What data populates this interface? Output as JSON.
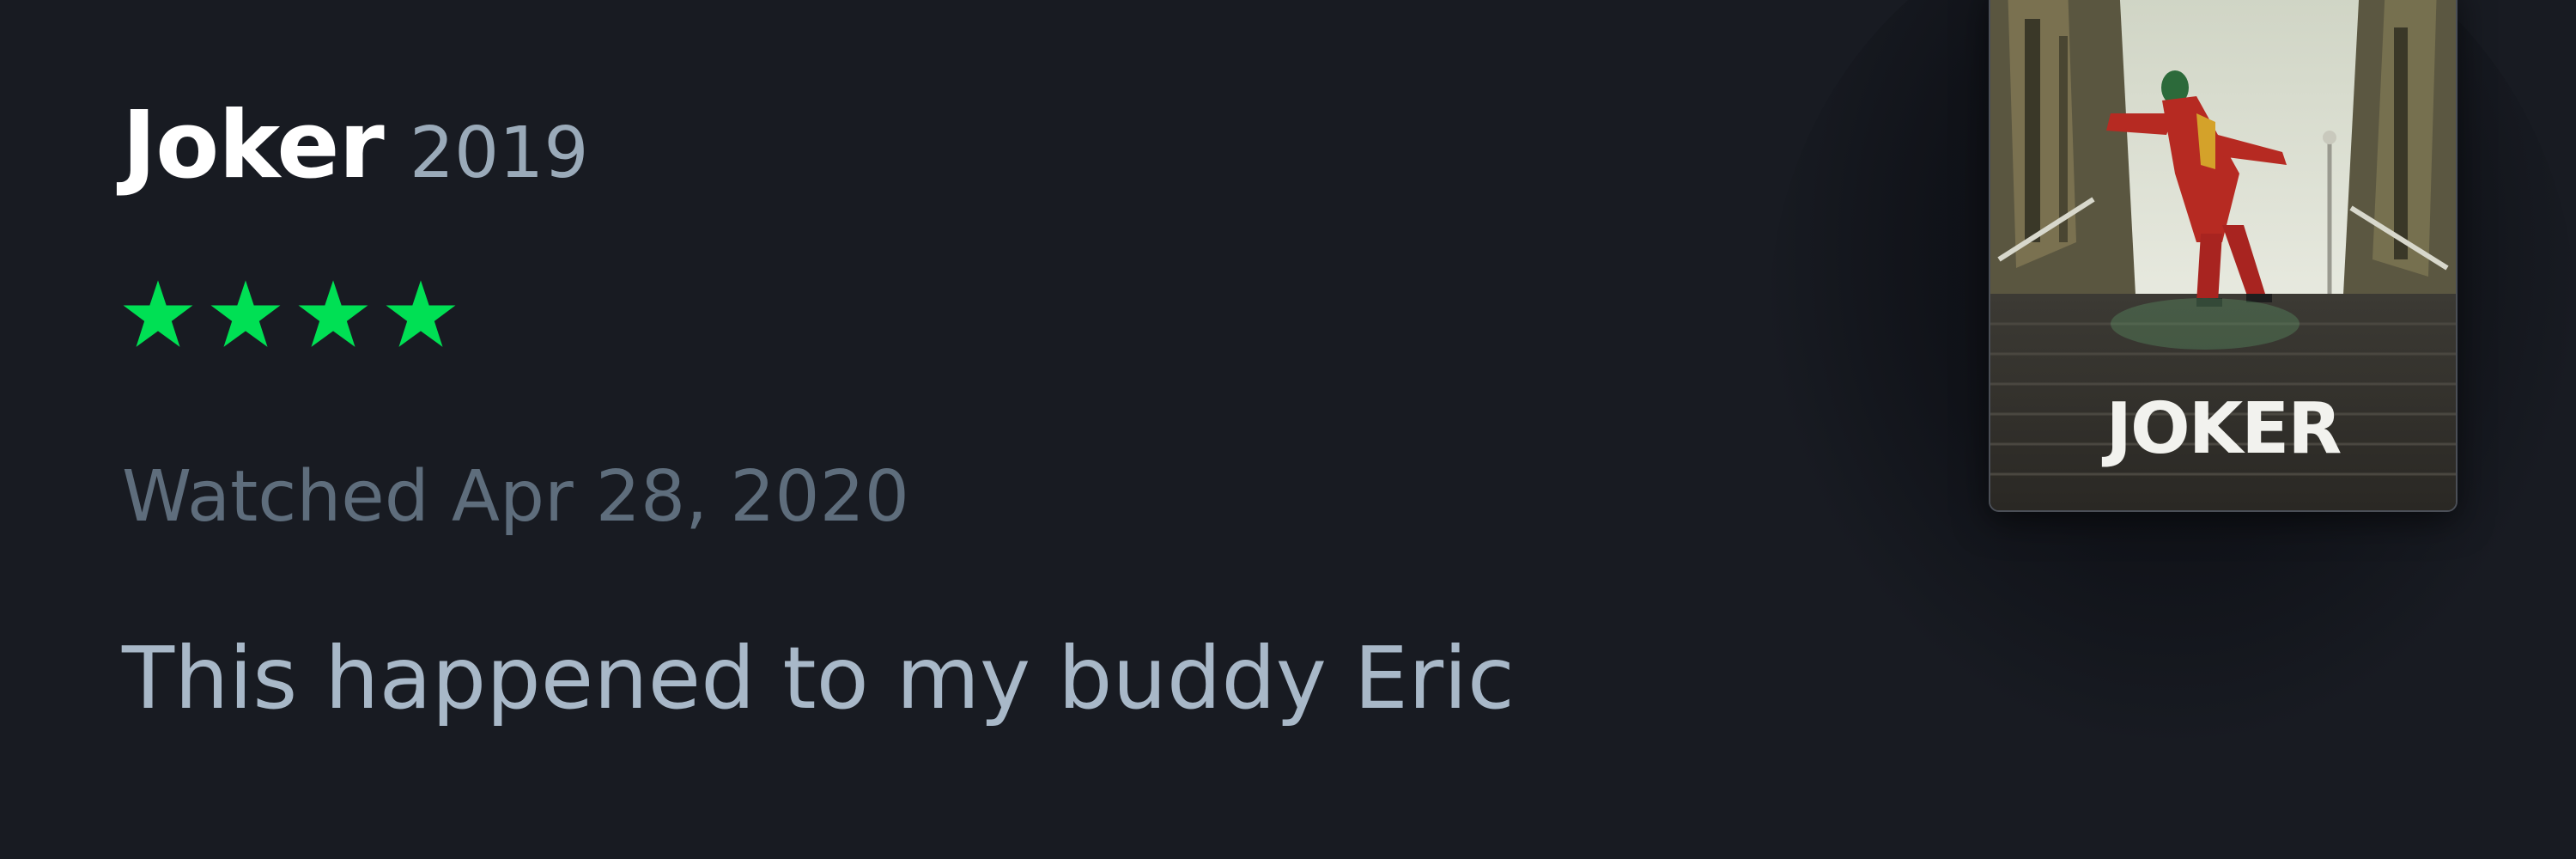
{
  "film": {
    "title": "Joker",
    "year": "2019"
  },
  "rating": {
    "value": 4,
    "max": 5,
    "color": "#00e054"
  },
  "diary": {
    "watched_text": "Watched Apr 28, 2020"
  },
  "review": {
    "text": "This happened to my buddy Eric"
  },
  "poster": {
    "title_text": "JOKER"
  },
  "colors": {
    "background": "#181b22",
    "title": "#ffffff",
    "year": "#9aaab9",
    "watched": "#5e6d7c",
    "review": "#a8b8c8"
  }
}
